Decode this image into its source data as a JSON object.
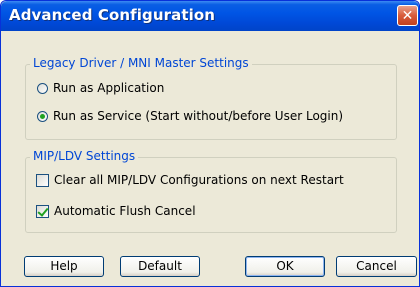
{
  "window": {
    "title": "Advanced Configuration",
    "close_glyph": "✕"
  },
  "legacy_group": {
    "legend": "Legacy Driver / MNI Master Settings",
    "options": [
      {
        "label": "Run as Application",
        "selected": false
      },
      {
        "label": "Run as Service (Start without/before User Login)",
        "selected": true
      }
    ]
  },
  "mip_group": {
    "legend": "MIP/LDV Settings",
    "options": [
      {
        "label": "Clear all MIP/LDV Configurations on next Restart",
        "checked": false
      },
      {
        "label": "Automatic Flush Cancel",
        "checked": true
      }
    ]
  },
  "buttons": {
    "help": "Help",
    "default": "Default",
    "ok": "OK",
    "cancel": "Cancel"
  }
}
